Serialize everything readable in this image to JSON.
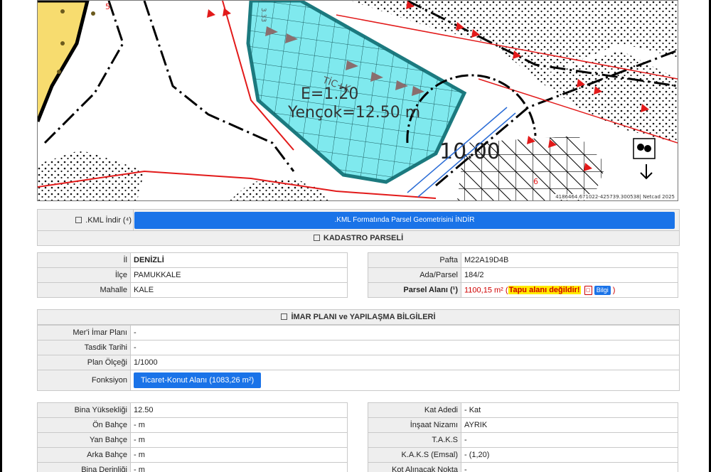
{
  "map": {
    "plan_text_1": "E=1.20",
    "plan_text_2": "Yençok=12.50 m",
    "plan_text_3": "TİC+K",
    "plan_text_4": "10.00",
    "small_text_1": "3.33",
    "small_text_2": "5",
    "small_text_3": "6",
    "credit": "4186464.671022-425739.300538| Netcad 2025"
  },
  "kml": {
    "label": ".KML İndir (⁴)",
    "button": ".KML Formatında Parsel Geometrisini İNDİR"
  },
  "kadastro": {
    "title": "KADASTRO PARSELİ",
    "left_rows": [
      {
        "label": "İl",
        "value": "DENİZLİ"
      },
      {
        "label": "İlçe",
        "value": "PAMUKKALE"
      },
      {
        "label": "Mahalle",
        "value": "KALE"
      }
    ],
    "pafta_label": "Pafta",
    "pafta_value": "M22A19D4B",
    "ada_label": "Ada/Parsel",
    "ada_value": "184/2",
    "alan_label": "Parsel Alanı (¹)",
    "alan_value": "1100,15 m²",
    "alan_open": " (",
    "alan_warning": "Tapu alanı değildir!",
    "alan_bilgi": "Bilgi",
    "alan_close": " )"
  },
  "imar": {
    "title": "İMAR PLANI ve YAPILAŞMA BİLGİLERİ",
    "rows": [
      {
        "label": "Mer'i İmar Planı",
        "value": "-"
      },
      {
        "label": "Tasdik Tarihi",
        "value": "-"
      },
      {
        "label": "Plan Ölçeği",
        "value": "1/1000"
      }
    ],
    "fonksiyon_label": "Fonksiyon",
    "fonksiyon_value": "Ticaret-Konut Alanı (1083,26 m²)"
  },
  "yapilasma": {
    "left_rows": [
      {
        "label": "Bina Yüksekliği",
        "value": "12.50"
      },
      {
        "label": "Ön Bahçe",
        "value": "- m"
      },
      {
        "label": "Yan Bahçe",
        "value": "- m"
      },
      {
        "label": "Arka Bahçe",
        "value": "- m"
      },
      {
        "label": "Bina Derinliği",
        "value": "- m"
      }
    ],
    "right_rows": [
      {
        "label": "Kat Adedi",
        "value": "- Kat"
      },
      {
        "label": "İnşaat Nizamı",
        "value": "AYRIK"
      },
      {
        "label": "T.A.K.S",
        "value": "-"
      },
      {
        "label": "K.A.K.S (Emsal)",
        "value": "- (1,20)"
      },
      {
        "label": "Kot Alınacak Nokta",
        "value": "-"
      }
    ]
  },
  "colors": {
    "accent": "#1a73e8",
    "parcel_fill": "#7fe9ee",
    "warning": "#ffeb00",
    "alert": "#d00000"
  }
}
